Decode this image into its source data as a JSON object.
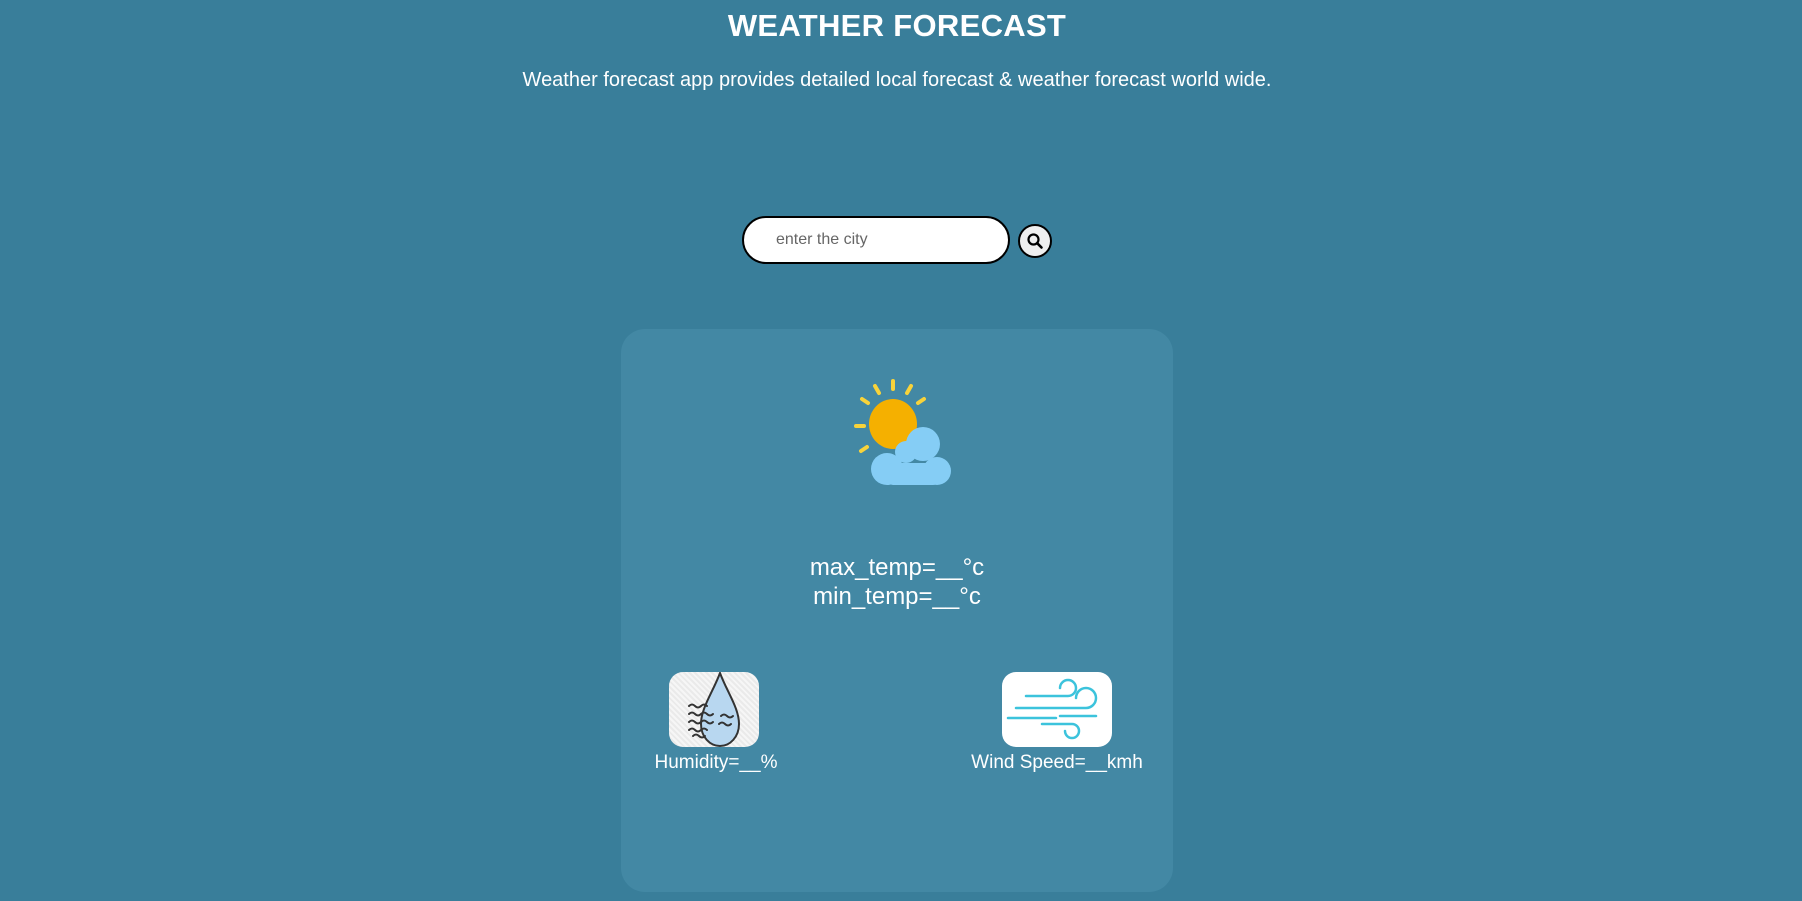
{
  "header": {
    "title": "WEATHER FORECAST",
    "subtitle": "Weather forecast app provides detailed local forecast & weather forecast world wide."
  },
  "search": {
    "placeholder": "enter the city",
    "value": "",
    "button_icon": "search-icon"
  },
  "card": {
    "weather_icon": "partly-cloudy-icon",
    "max_temp": "max_temp=__°c",
    "min_temp": "min_temp=__°c",
    "humidity": {
      "icon": "humidity-icon",
      "label": "Humidity=__%"
    },
    "wind": {
      "icon": "wind-icon",
      "label": "Wind Speed=__kmh"
    }
  },
  "colors": {
    "background": "#397e9a",
    "card": "#4388a4",
    "sun": "#f5b000",
    "sun_rays": "#f8d33a",
    "cloud": "#85cdf5",
    "wind": "#3cc3dc"
  }
}
